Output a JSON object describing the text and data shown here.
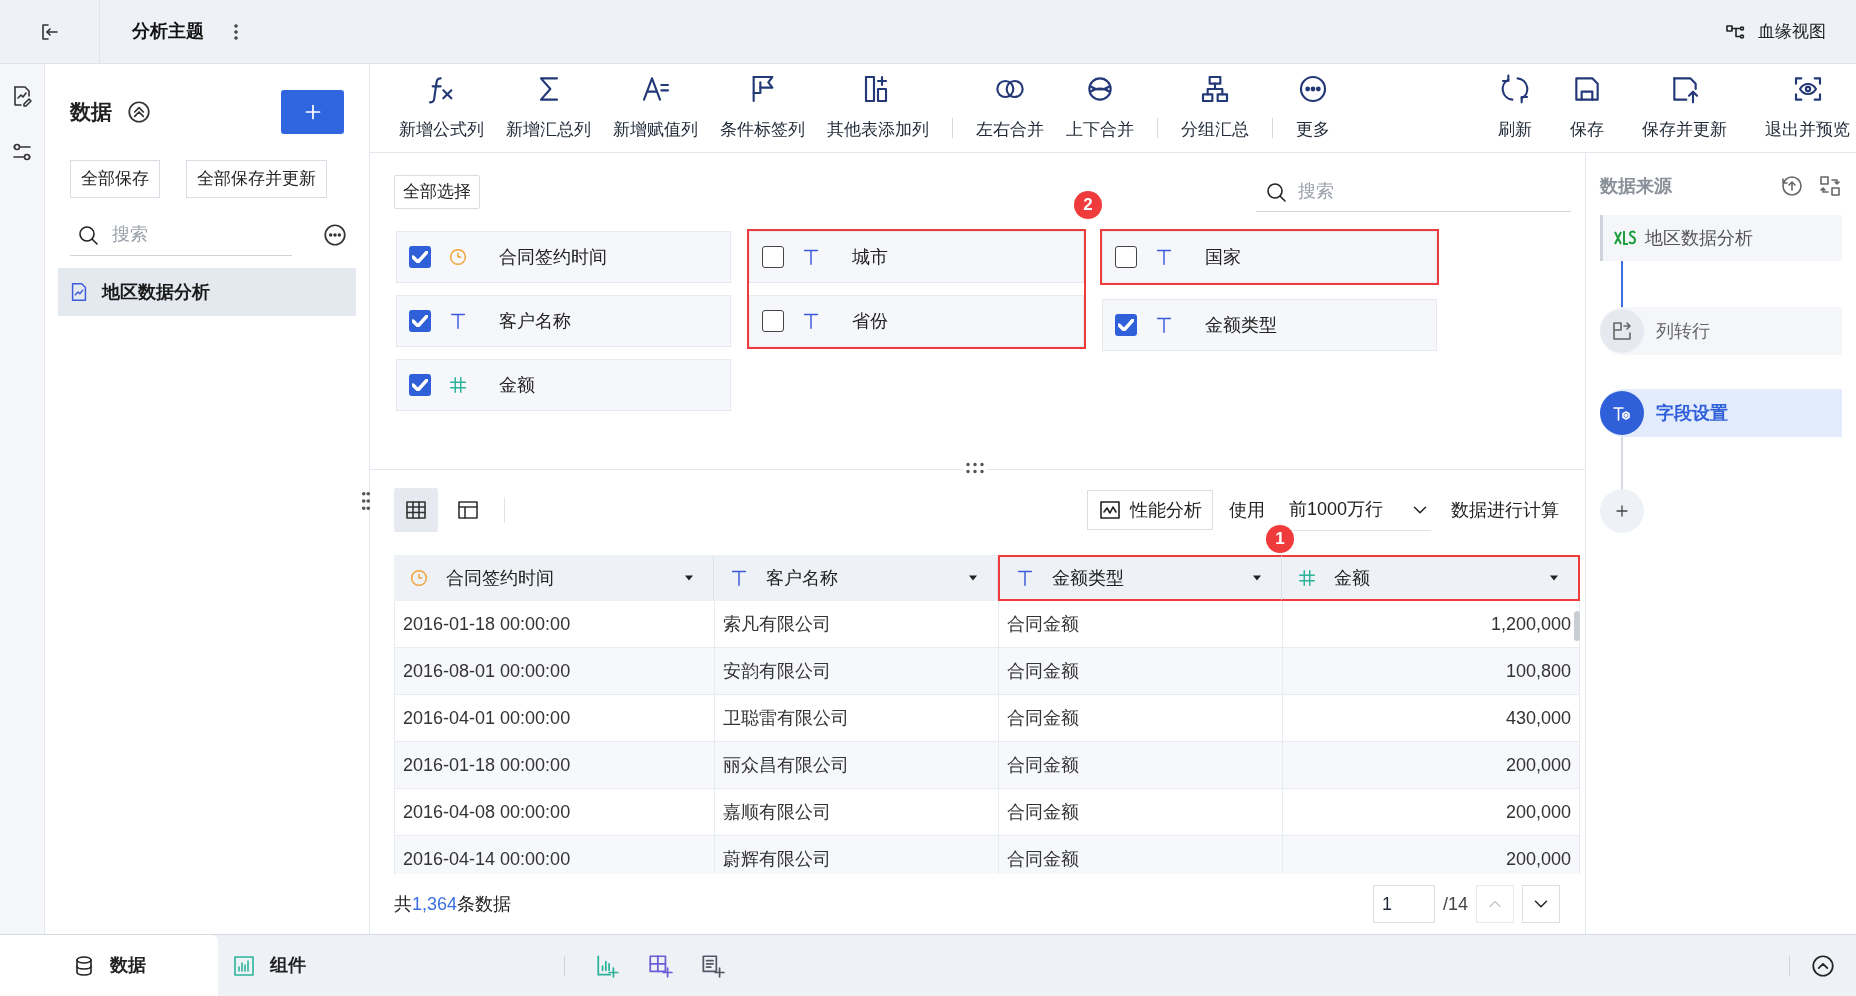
{
  "top_bar": {
    "title": "分析主题",
    "lineage_button": "血缘视图"
  },
  "left_panel": {
    "title": "数据",
    "buttons": [
      "全部保存",
      "全部保存并更新"
    ],
    "search": {
      "placeholder": "搜索"
    },
    "tree": [
      {
        "label": "地区数据分析",
        "selected": true
      }
    ]
  },
  "toolbar": {
    "groups": [
      {
        "items": [
          "新增公式列",
          "新增汇总列",
          "新增赋值列",
          "条件标签列",
          "其他表添加列"
        ]
      },
      {
        "items": [
          "左右合并",
          "上下合并"
        ]
      },
      {
        "items": [
          "分组汇总"
        ]
      },
      {
        "items": [
          "更多"
        ]
      }
    ],
    "right_items": [
      "刷新",
      "保存",
      "保存并更新",
      "退出并预览"
    ]
  },
  "fields": {
    "select_all": "全部选择",
    "search": {
      "placeholder": "搜索"
    },
    "badge": "2",
    "columns": [
      [
        {
          "highlighted": false,
          "fields": [
            {
              "name": "合同签约时间",
              "kind": "time",
              "checked": true
            },
            {
              "name": "客户名称",
              "kind": "text",
              "checked": true
            },
            {
              "name": "金额",
              "kind": "number",
              "checked": true
            }
          ]
        }
      ],
      [
        {
          "highlighted": true,
          "fields": [
            {
              "name": "城市",
              "kind": "text",
              "checked": false
            },
            {
              "name": "省份",
              "kind": "text",
              "checked": false
            }
          ]
        }
      ],
      [
        {
          "highlighted": true,
          "fields": [
            {
              "name": "国家",
              "kind": "text",
              "checked": false
            }
          ]
        },
        {
          "highlighted": false,
          "fields": [
            {
              "name": "金额类型",
              "kind": "text",
              "checked": true
            }
          ]
        }
      ]
    ]
  },
  "preview": {
    "views": [
      {
        "selected": true
      },
      {
        "selected": false
      }
    ],
    "perf_button": "性能分析",
    "use_label": "使用",
    "row_limit": "前1000万行",
    "compute_label": "数据进行计算",
    "badge": "1",
    "table": {
      "columns": [
        {
          "name": "合同签约时间",
          "kind": "time",
          "highlighted": false
        },
        {
          "name": "客户名称",
          "kind": "text",
          "highlighted": false
        },
        {
          "name": "金额类型",
          "kind": "text",
          "highlighted": true
        },
        {
          "name": "金额",
          "kind": "number",
          "highlighted": true
        }
      ],
      "rows": [
        [
          "2016-01-18 00:00:00",
          "索凡有限公司",
          "合同金额",
          "1,200,000"
        ],
        [
          "2016-08-01 00:00:00",
          "安韵有限公司",
          "合同金额",
          "100,800"
        ],
        [
          "2016-04-01 00:00:00",
          "卫聪雷有限公司",
          "合同金额",
          "430,000"
        ],
        [
          "2016-01-18 00:00:00",
          "丽众昌有限公司",
          "合同金额",
          "200,000"
        ],
        [
          "2016-04-08 00:00:00",
          "嘉顺有限公司",
          "合同金额",
          "200,000"
        ],
        [
          "2016-04-14 00:00:00",
          "蔚辉有限公司",
          "合同金额",
          "200,000"
        ]
      ]
    },
    "total": {
      "prefix": "共",
      "count": "1,364",
      "suffix": "条数据"
    },
    "pager": {
      "page": "1",
      "pages": "/14"
    }
  },
  "right_panel": {
    "title": "数据来源",
    "steps": [
      {
        "kind": "source",
        "label": "地区数据分析",
        "selected": false
      },
      {
        "kind": "step",
        "label": "列转行",
        "selected": false
      },
      {
        "kind": "step",
        "label": "字段设置",
        "selected": true
      }
    ]
  },
  "bottom_tabs": [
    {
      "label": "数据",
      "selected": true
    },
    {
      "label": "组件",
      "selected": false
    }
  ]
}
